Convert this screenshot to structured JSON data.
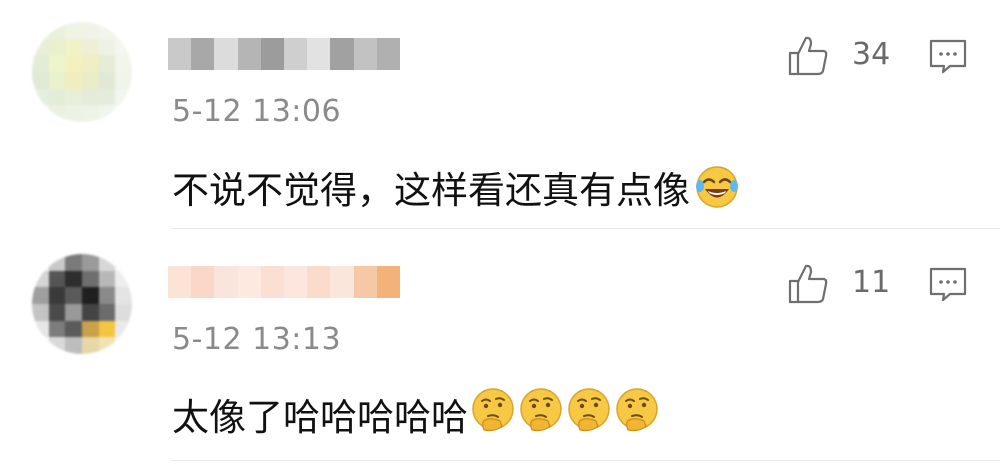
{
  "comments": [
    {
      "time": "5-12 13:06",
      "text": "不说不觉得，这样看还真有点像",
      "likes": "34",
      "emojis": [
        "laugh-cry-emoji"
      ],
      "avatar_colors": [
        "#eef3e6",
        "#e8f1dc",
        "#eff4e4",
        "#f1f3e8",
        "#f2f5ec",
        "#f6f7f2",
        "#e8efd8",
        "#e9f0d0",
        "#f0f2c8",
        "#eef0d6",
        "#eef2e4",
        "#f4f6ef",
        "#e3ecd5",
        "#eef4cc",
        "#f5f1bf",
        "#f0eec3",
        "#e6ecd8",
        "#f2f5ec",
        "#dfe9d3",
        "#e9f1cd",
        "#f0edc0",
        "#eaecc9",
        "#e1e9d6",
        "#f0f4ea",
        "#e6eee0",
        "#e2ecd6",
        "#e8efd9",
        "#e4ecd9",
        "#e5ecde",
        "#f3f6ef",
        "#f1f5ec",
        "#eaf1e2",
        "#edf2e5",
        "#eef3e8",
        "#f1f5ed",
        "#f7f9f4"
      ],
      "username_colors": [
        "#c9c9c9",
        "#a8a8a8",
        "#dcdcdc",
        "#b5b5b5",
        "#9c9c9c",
        "#cfcfcf",
        "#e2e2e2",
        "#a1a1a1",
        "#c2c2c2",
        "#b0b0b0"
      ]
    },
    {
      "time": "5-12 13:13",
      "text": "太像了哈哈哈哈哈",
      "likes": "11",
      "emojis": [
        "thinking-emoji",
        "thinking-emoji",
        "thinking-emoji",
        "thinking-emoji"
      ],
      "avatar_colors": [
        "#f0f0f0",
        "#c9c9c9",
        "#7a7a7a",
        "#9a9a9a",
        "#d8d8d8",
        "#f5f5f5",
        "#d5d5d5",
        "#555555",
        "#2e2e2e",
        "#6e6e6e",
        "#b8b8b8",
        "#eeeeee",
        "#9f9f9f",
        "#3a3a3a",
        "#5a5a5a",
        "#202020",
        "#8a8a8a",
        "#e4e4e4",
        "#c4c4c4",
        "#4a4a4a",
        "#999999",
        "#444444",
        "#6c6c6c",
        "#dddddd",
        "#e6e6e6",
        "#7c7c7c",
        "#5b5b5b",
        "#c7a24a",
        "#f4c542",
        "#eaeaea",
        "#f7f7f7",
        "#dadada",
        "#bdbdbd",
        "#e7d8a8",
        "#f3e2b5",
        "#f8f8f8"
      ],
      "username_colors": [
        "#fbe3d6",
        "#fbd7c7",
        "#f9e5dc",
        "#fde9df",
        "#fbdfd3",
        "#fde6dd",
        "#fadbcc",
        "#fbe6dc",
        "#f5c9a5",
        "#f4b27a"
      ]
    }
  ]
}
